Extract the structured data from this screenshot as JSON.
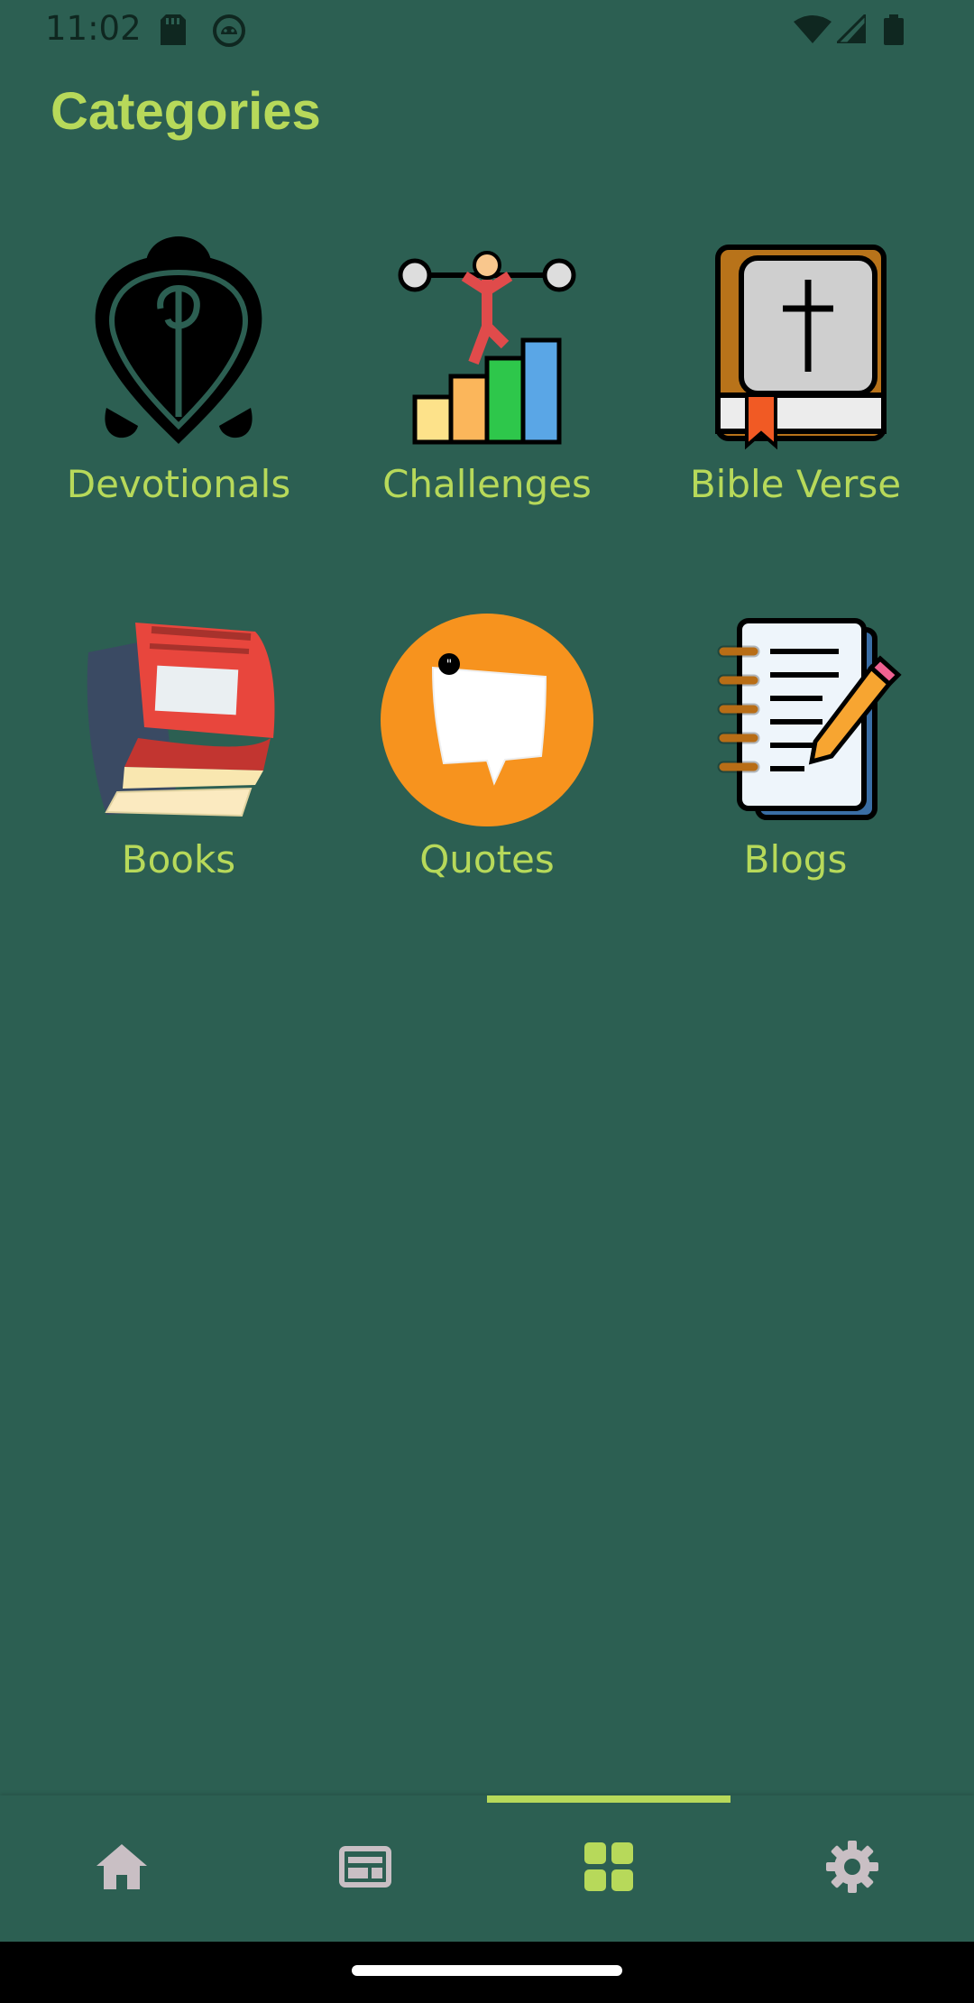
{
  "status_bar": {
    "time": "11:02",
    "icons": [
      "sd-card-icon",
      "android-debug-icon",
      "wifi-icon",
      "signal-icon",
      "battery-icon"
    ]
  },
  "page": {
    "title": "Categories"
  },
  "categories": [
    {
      "label": "Devotionals",
      "icon": "devotional-cross-icon"
    },
    {
      "label": "Challenges",
      "icon": "weightlifter-chart-icon"
    },
    {
      "label": "Bible Verse",
      "icon": "bible-icon"
    },
    {
      "label": "Books",
      "icon": "books-icon"
    },
    {
      "label": "Quotes",
      "icon": "quote-bubble-icon"
    },
    {
      "label": "Blogs",
      "icon": "notebook-pencil-icon"
    }
  ],
  "bottom_nav": {
    "items": [
      {
        "icon": "home-icon",
        "selected": false
      },
      {
        "icon": "news-icon",
        "selected": false
      },
      {
        "icon": "grid-categories-icon",
        "selected": true
      },
      {
        "icon": "gear-icon",
        "selected": false
      }
    ]
  },
  "colors": {
    "background": "#2c5f52",
    "accent": "#b7d95a",
    "nav_inactive": "#c9bfc4"
  }
}
